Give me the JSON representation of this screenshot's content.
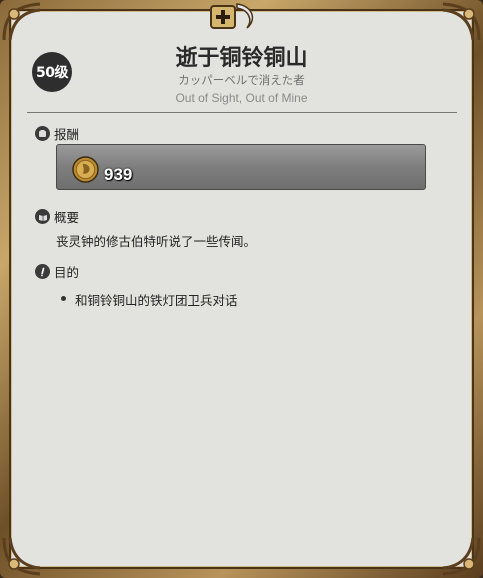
{
  "quest": {
    "level": "50级",
    "title": "逝于铜铃铜山",
    "subtitle_jp": "カッパーベルで消えた者",
    "subtitle_en": "Out of Sight, Out of Mine"
  },
  "reward": {
    "label": "报酬",
    "gil_amount": "939",
    "icon": "gil-coin-icon"
  },
  "summary": {
    "label": "概要",
    "text": "丧灵钟的修古伯特听说了一些传闻。",
    "icon": "book-icon"
  },
  "objective": {
    "label": "目的",
    "items": [
      "和铜铃铜山的铁灯团卫兵对话"
    ],
    "icon": "exclamation-icon"
  },
  "colors": {
    "panel_bg": "#e2e3de",
    "frame_gold": "#c9a76a",
    "reward_box": "#7e7e7e",
    "badge_bg": "#2e2e2e"
  }
}
